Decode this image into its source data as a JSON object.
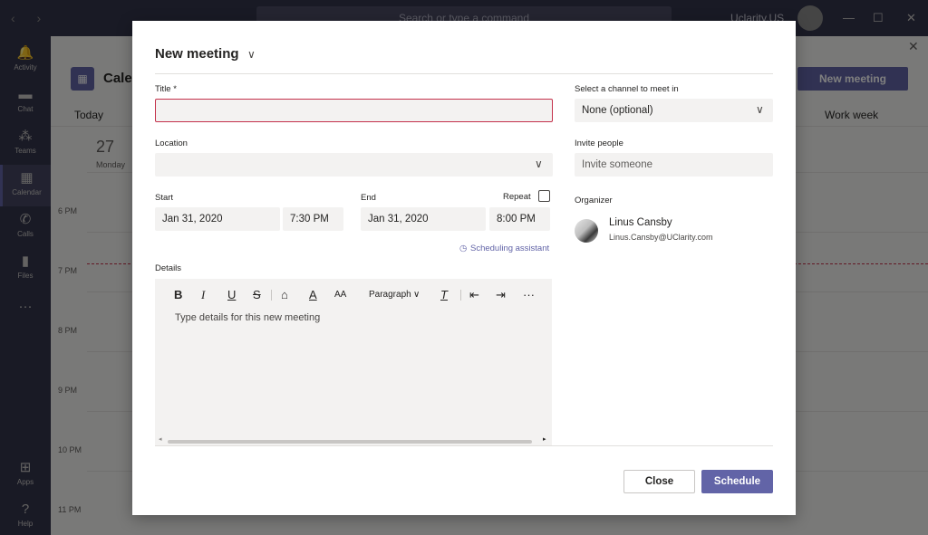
{
  "background": {
    "search_placeholder": "Search or type a command",
    "org_name": "Uclarity.US",
    "rail": [
      {
        "label": "Activity",
        "icon": "bell-icon"
      },
      {
        "label": "Chat",
        "icon": "chat-icon"
      },
      {
        "label": "Teams",
        "icon": "teams-icon"
      },
      {
        "label": "Calendar",
        "icon": "calendar-icon"
      },
      {
        "label": "Calls",
        "icon": "phone-icon"
      },
      {
        "label": "Files",
        "icon": "file-icon"
      },
      {
        "label": "Apps",
        "icon": "apps-icon"
      },
      {
        "label": "Help",
        "icon": "help-icon"
      }
    ],
    "calendar_title": "Calendar",
    "today_label": "Today",
    "new_meeting_label": "New meeting",
    "work_week_label": "Work week",
    "day_number": "27",
    "day_name": "Monday",
    "hours": [
      "6 PM",
      "7 PM",
      "8 PM",
      "9 PM",
      "10 PM",
      "11 PM"
    ]
  },
  "dialog": {
    "title": "New meeting",
    "title_label": "Title *",
    "title_value": "",
    "location_label": "Location",
    "location_value": "",
    "start_label": "Start",
    "start_date": "Jan 31, 2020",
    "start_time": "7:30 PM",
    "end_label": "End",
    "end_date": "Jan 31, 2020",
    "end_time": "8:00 PM",
    "repeat_label": "Repeat",
    "scheduling_assistant": "Scheduling assistant",
    "details_label": "Details",
    "toolbar": {
      "bold": "B",
      "italic": "I",
      "underline": "U",
      "strike": "S",
      "paragraph": "Paragraph"
    },
    "details_placeholder": "Type details for this new meeting",
    "channel_label": "Select a channel to meet in",
    "channel_value": "None (optional)",
    "invite_label": "Invite people",
    "invite_placeholder": "Invite someone",
    "organizer_label": "Organizer",
    "organizer_name": "Linus Cansby",
    "organizer_email": "Linus.Cansby@UClarity.com",
    "close_label": "Close",
    "schedule_label": "Schedule"
  },
  "colors": {
    "accent": "#6264a7",
    "error_border": "#c4314b",
    "field_bg": "#f3f2f1",
    "rail_bg": "#33344a"
  }
}
